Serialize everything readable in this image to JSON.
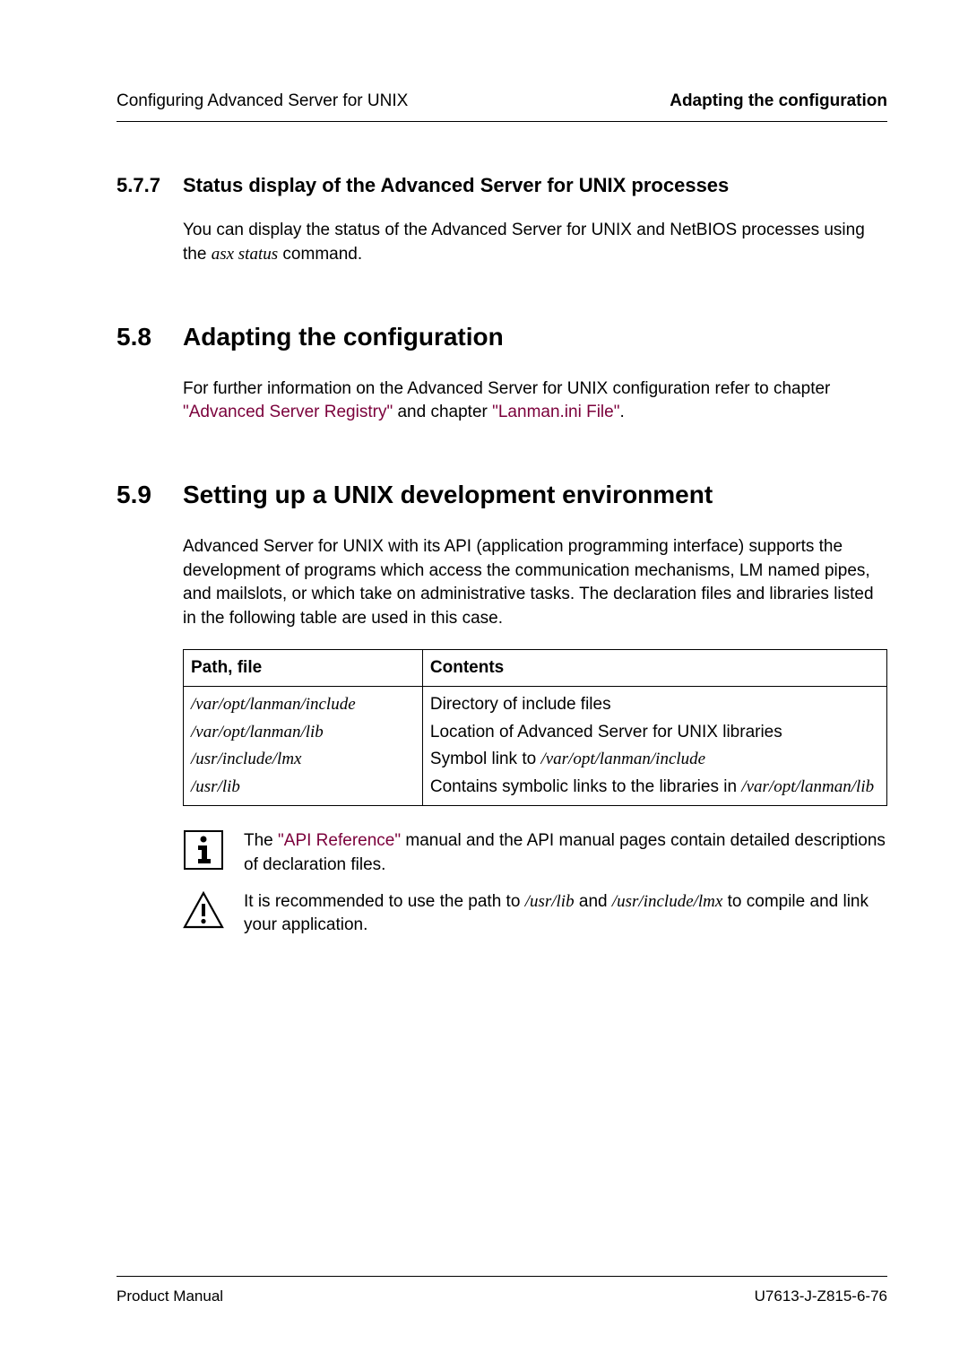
{
  "header": {
    "left": "Configuring Advanced Server for UNIX",
    "right": "Adapting the configuration"
  },
  "section_577": {
    "num": "5.7.7",
    "title": "Status display of the Advanced Server for UNIX processes",
    "para_pre": "You can display the status of the Advanced Server for UNIX and NetBIOS processes using the ",
    "cmd": "asx status",
    "para_post": " command."
  },
  "section_58": {
    "num": "5.8",
    "title": "Adapting the configuration",
    "para_pre": "For further information on the Advanced Server for UNIX configuration refer to chapter ",
    "link1": "\"Advanced Server Registry\"",
    "mid": " and chapter ",
    "link2": "\"Lanman.ini File\"",
    "post": "."
  },
  "section_59": {
    "num": "5.9",
    "title": "Setting up a UNIX development environment",
    "para": "Advanced Server for UNIX with its API (application programming interface) supports the development of programs which access the communication mechanisms, LM named pipes, and mailslots, or which take on administrative tasks. The declaration files and libraries listed in the following table are used in this case."
  },
  "table": {
    "headers": {
      "c1": "Path, file",
      "c2": "Contents"
    },
    "rows": [
      {
        "path": "/var/opt/lanman/include",
        "desc": "Directory of include files"
      },
      {
        "path": "/var/opt/lanman/lib",
        "desc": "Location of Advanced Server for UNIX libraries"
      },
      {
        "path": "/usr/include/lmx",
        "desc_pre": "Symbol link to ",
        "desc_it": "/var/opt/lanman/include"
      },
      {
        "path": "/usr/lib",
        "desc_pre": "Contains symbolic links to the libraries in ",
        "desc_it": "/var/opt/lanman/lib"
      }
    ]
  },
  "note_info": {
    "pre": "The ",
    "link": "\"API Reference\"",
    "post": " manual and the API manual pages contain detailed descriptions of declaration files."
  },
  "note_warn": {
    "pre": "It is recommended to use the path to ",
    "it1": "/usr/lib",
    "mid": " and ",
    "it2": "/usr/include/lmx",
    "post": " to compile and link your application."
  },
  "footer": {
    "left": "Product Manual",
    "right": "U7613-J-Z815-6-76"
  }
}
